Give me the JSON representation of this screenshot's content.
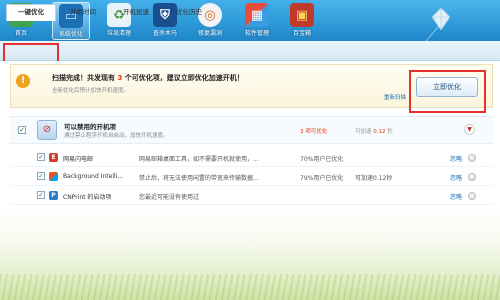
{
  "colors": {
    "accent": "#2d9ad9",
    "highlight": "#e53030",
    "warning": "#f0a21a",
    "value_red": "#e03a0e"
  },
  "toolbar": {
    "items": [
      {
        "label": "首页",
        "icon": "home-icon"
      },
      {
        "label": "系统优化",
        "icon": "monitor-icon"
      },
      {
        "label": "垃圾清理",
        "icon": "trash-icon"
      },
      {
        "label": "查杀木马",
        "icon": "shield-icon"
      },
      {
        "label": "修复漏洞",
        "icon": "repair-icon"
      },
      {
        "label": "软件管理",
        "icon": "apps-icon"
      },
      {
        "label": "百宝箱",
        "icon": "toolbox-icon"
      }
    ]
  },
  "tabs": [
    "一键优化",
    "开机时间",
    "开机加速",
    "优化历史"
  ],
  "scan": {
    "title_prefix": "扫描完成！共发现有",
    "count": "3",
    "title_suffix": "个可优化项，建议立即优化加速开机！",
    "subtitle": "全新优化后预计加快开机速度。",
    "rescan": "重新扫描",
    "optimize_button": "立即优化"
  },
  "group": {
    "title": "可以禁用的开机项",
    "subtitle": "通过禁止程序开机自启动，加快开机速度。",
    "count_text": "3 项可优化",
    "speed_prefix": "可加速",
    "speed_value": "0.12",
    "speed_unit": "秒"
  },
  "items": [
    {
      "name": "网易闪电邮",
      "desc": "网易邮箱桌面工具，如不需要开机就使用，...",
      "pct": "70%用户已优化",
      "speed": "",
      "ignore": "忽略"
    },
    {
      "name": "Background Intelli...",
      "desc": "禁止后，将无法使用闲置的带宽来传输数据...",
      "pct": "79%用户已优化",
      "speed": "可加速0.12秒",
      "ignore": "忽略"
    },
    {
      "name": "CNPrint 的启动项",
      "desc": "您最近可能没有使用过",
      "pct": "",
      "speed": "",
      "ignore": "忽略"
    }
  ]
}
